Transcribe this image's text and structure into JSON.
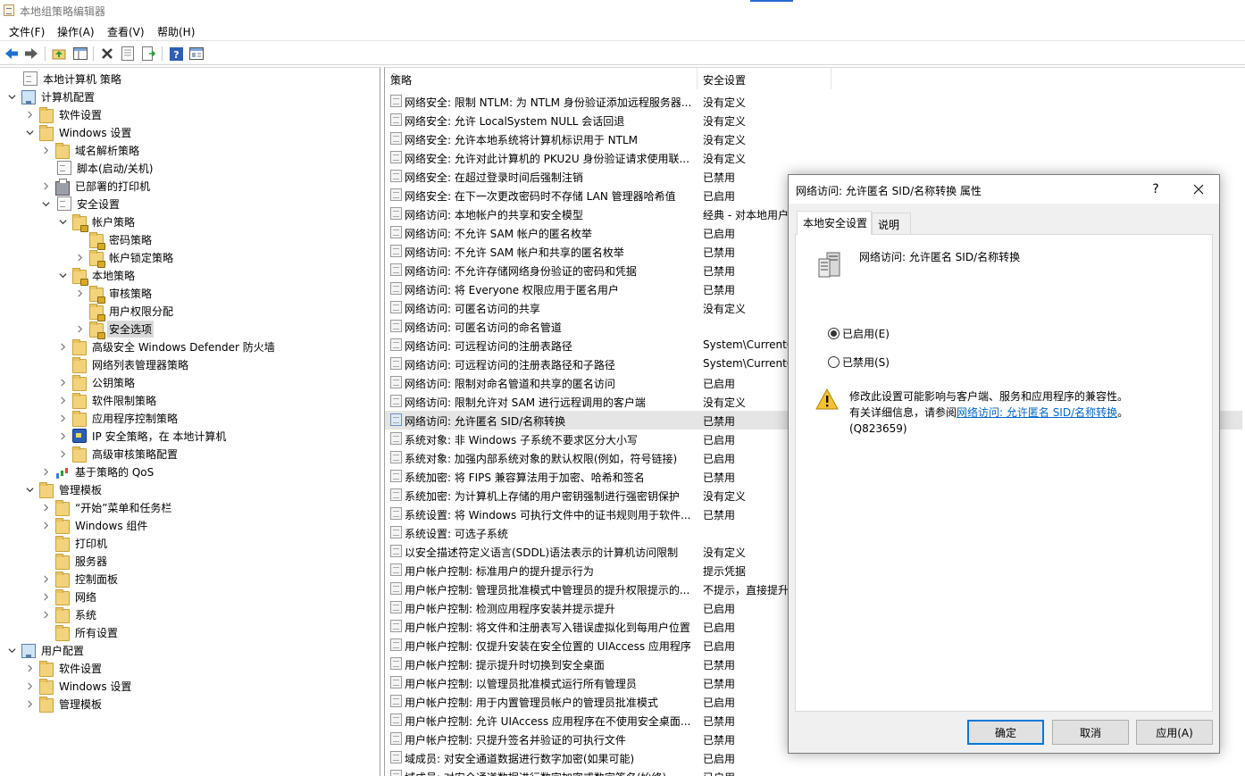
{
  "window": {
    "title": "本地组策略编辑器"
  },
  "menu": [
    "文件(F)",
    "操作(A)",
    "查看(V)",
    "帮助(H)"
  ],
  "toolbar": {
    "buttons": [
      "back-icon",
      "forward-icon",
      "up-folder-icon",
      "show-hide-tree-icon",
      "delete-icon",
      "properties-icon",
      "export-list-icon",
      "help-icon",
      "view-icon"
    ]
  },
  "tree": [
    {
      "label": "本地计算机 策略",
      "level": 0,
      "expander": "none",
      "icon": "policy-doc-icon"
    },
    {
      "label": "计算机配置",
      "level": 0,
      "expander": "open",
      "icon": "computer-icon"
    },
    {
      "label": "软件设置",
      "level": 1,
      "expander": "closed",
      "icon": "folder-icon"
    },
    {
      "label": "Windows 设置",
      "level": 1,
      "expander": "open",
      "icon": "folder-icon"
    },
    {
      "label": "域名解析策略",
      "level": 2,
      "expander": "closed",
      "icon": "folder-icon"
    },
    {
      "label": "脚本(启动/关机)",
      "level": 2,
      "expander": "none",
      "icon": "script-icon"
    },
    {
      "label": "已部署的打印机",
      "level": 2,
      "expander": "closed",
      "icon": "printer-icon"
    },
    {
      "label": "安全设置",
      "level": 2,
      "expander": "open",
      "icon": "security-settings-icon"
    },
    {
      "label": "帐户策略",
      "level": 3,
      "expander": "open",
      "icon": "folder-lock-icon"
    },
    {
      "label": "密码策略",
      "level": 4,
      "expander": "none",
      "icon": "folder-lock-icon"
    },
    {
      "label": "帐户锁定策略",
      "level": 4,
      "expander": "closed",
      "icon": "folder-lock-icon"
    },
    {
      "label": "本地策略",
      "level": 3,
      "expander": "open",
      "icon": "folder-lock-icon"
    },
    {
      "label": "审核策略",
      "level": 4,
      "expander": "closed",
      "icon": "folder-lock-icon"
    },
    {
      "label": "用户权限分配",
      "level": 4,
      "expander": "none",
      "icon": "folder-lock-icon"
    },
    {
      "label": "安全选项",
      "level": 4,
      "expander": "closed",
      "icon": "folder-lock-icon",
      "selected": true
    },
    {
      "label": "高级安全 Windows Defender 防火墙",
      "level": 3,
      "expander": "closed",
      "icon": "folder-icon"
    },
    {
      "label": "网络列表管理器策略",
      "level": 3,
      "expander": "none",
      "icon": "folder-icon"
    },
    {
      "label": "公钥策略",
      "level": 3,
      "expander": "closed",
      "icon": "folder-icon"
    },
    {
      "label": "软件限制策略",
      "level": 3,
      "expander": "closed",
      "icon": "folder-icon"
    },
    {
      "label": "应用程序控制策略",
      "level": 3,
      "expander": "closed",
      "icon": "folder-icon"
    },
    {
      "label": "IP 安全策略，在 本地计算机",
      "level": 3,
      "expander": "closed",
      "icon": "ip-security-icon"
    },
    {
      "label": "高级审核策略配置",
      "level": 3,
      "expander": "closed",
      "icon": "folder-icon"
    },
    {
      "label": "基于策略的 QoS",
      "level": 2,
      "expander": "closed",
      "icon": "qos-chart-icon"
    },
    {
      "label": "管理模板",
      "level": 1,
      "expander": "open",
      "icon": "folder-icon"
    },
    {
      "label": "“开始”菜单和任务栏",
      "level": 2,
      "expander": "closed",
      "icon": "folder-icon"
    },
    {
      "label": "Windows 组件",
      "level": 2,
      "expander": "closed",
      "icon": "folder-icon"
    },
    {
      "label": "打印机",
      "level": 2,
      "expander": "none",
      "icon": "folder-icon"
    },
    {
      "label": "服务器",
      "level": 2,
      "expander": "none",
      "icon": "folder-icon"
    },
    {
      "label": "控制面板",
      "level": 2,
      "expander": "closed",
      "icon": "folder-icon"
    },
    {
      "label": "网络",
      "level": 2,
      "expander": "closed",
      "icon": "folder-icon"
    },
    {
      "label": "系统",
      "level": 2,
      "expander": "closed",
      "icon": "folder-icon"
    },
    {
      "label": "所有设置",
      "level": 2,
      "expander": "none",
      "icon": "folder-doc-icon"
    },
    {
      "label": "用户配置",
      "level": 0,
      "expander": "open",
      "icon": "user-icon"
    },
    {
      "label": "软件设置",
      "level": 1,
      "expander": "closed",
      "icon": "folder-icon"
    },
    {
      "label": "Windows 设置",
      "level": 1,
      "expander": "closed",
      "icon": "folder-icon"
    },
    {
      "label": "管理模板",
      "level": 1,
      "expander": "closed",
      "icon": "folder-icon"
    }
  ],
  "list": {
    "columns": [
      "策略",
      "安全设置"
    ],
    "rows": [
      {
        "policy": "网络安全: 限制 NTLM: 为 NTLM 身份验证添加远程服务器...",
        "setting": "没有定义"
      },
      {
        "policy": "网络安全: 允许 LocalSystem NULL 会话回退",
        "setting": "没有定义"
      },
      {
        "policy": "网络安全: 允许本地系统将计算机标识用于 NTLM",
        "setting": "没有定义"
      },
      {
        "policy": "网络安全: 允许对此计算机的 PKU2U 身份验证请求使用联...",
        "setting": "没有定义"
      },
      {
        "policy": "网络安全: 在超过登录时间后强制注销",
        "setting": "已禁用"
      },
      {
        "policy": "网络安全: 在下一次更改密码时不存储 LAN 管理器哈希值",
        "setting": "已启用"
      },
      {
        "policy": "网络访问: 本地帐户的共享和安全模型",
        "setting": "经典 - 对本地用户"
      },
      {
        "policy": "网络访问: 不允许 SAM 帐户的匿名枚举",
        "setting": "已启用"
      },
      {
        "policy": "网络访问: 不允许 SAM 帐户和共享的匿名枚举",
        "setting": "已禁用"
      },
      {
        "policy": "网络访问: 不允许存储网络身份验证的密码和凭据",
        "setting": "已禁用"
      },
      {
        "policy": "网络访问: 将 Everyone 权限应用于匿名用户",
        "setting": "已禁用"
      },
      {
        "policy": "网络访问: 可匿名访问的共享",
        "setting": "没有定义"
      },
      {
        "policy": "网络访问: 可匿名访问的命名管道",
        "setting": ""
      },
      {
        "policy": "网络访问: 可远程访问的注册表路径",
        "setting": "System\\CurrentC"
      },
      {
        "policy": "网络访问: 可远程访问的注册表路径和子路径",
        "setting": "System\\CurrentC"
      },
      {
        "policy": "网络访问: 限制对命名管道和共享的匿名访问",
        "setting": "已启用"
      },
      {
        "policy": "网络访问: 限制允许对 SAM 进行远程调用的客户端",
        "setting": "没有定义"
      },
      {
        "policy": "网络访问: 允许匿名 SID/名称转换",
        "setting": "已禁用",
        "selected": true
      },
      {
        "policy": "系统对象: 非 Windows 子系统不要求区分大小写",
        "setting": "已启用"
      },
      {
        "policy": "系统对象: 加强内部系统对象的默认权限(例如，符号链接)",
        "setting": "已启用"
      },
      {
        "policy": "系统加密: 将 FIPS 兼容算法用于加密、哈希和签名",
        "setting": "已禁用"
      },
      {
        "policy": "系统加密: 为计算机上存储的用户密钥强制进行强密钥保护",
        "setting": "没有定义"
      },
      {
        "policy": "系统设置: 将 Windows 可执行文件中的证书规则用于软件...",
        "setting": "已禁用"
      },
      {
        "policy": "系统设置: 可选子系统",
        "setting": ""
      },
      {
        "policy": "以安全描述符定义语言(SDDL)语法表示的计算机访问限制",
        "setting": "没有定义"
      },
      {
        "policy": "用户帐户控制: 标准用户的提升提示行为",
        "setting": "提示凭据"
      },
      {
        "policy": "用户帐户控制: 管理员批准模式中管理员的提升权限提示的...",
        "setting": "不提示，直接提升"
      },
      {
        "policy": "用户帐户控制: 检测应用程序安装并提示提升",
        "setting": "已启用"
      },
      {
        "policy": "用户帐户控制: 将文件和注册表写入错误虚拟化到每用户位置",
        "setting": "已启用"
      },
      {
        "policy": "用户帐户控制: 仅提升安装在安全位置的 UIAccess 应用程序",
        "setting": "已启用"
      },
      {
        "policy": "用户帐户控制: 提示提升时切换到安全桌面",
        "setting": "已禁用"
      },
      {
        "policy": "用户帐户控制: 以管理员批准模式运行所有管理员",
        "setting": "已禁用"
      },
      {
        "policy": "用户帐户控制: 用于内置管理员帐户的管理员批准模式",
        "setting": "已启用"
      },
      {
        "policy": "用户帐户控制: 允许 UIAccess 应用程序在不使用安全桌面...",
        "setting": "已禁用"
      },
      {
        "policy": "用户帐户控制: 只提升签名并验证的可执行文件",
        "setting": "已禁用"
      },
      {
        "policy": "域成员: 对安全通道数据进行数字加密(如果可能)",
        "setting": "已启用"
      },
      {
        "policy": "域成员: 对安全通道数据进行数字加密或数字签名(始终)",
        "setting": "已启用"
      }
    ]
  },
  "dialog": {
    "title": "网络访问: 允许匿名 SID/名称转换 属性",
    "help_glyph": "?",
    "close_glyph": "✕",
    "tabs": [
      "本地安全设置",
      "说明"
    ],
    "active_tab": 0,
    "policy_name": "网络访问: 允许匿名 SID/名称转换",
    "options": [
      {
        "label": "已启用(E)",
        "checked": true
      },
      {
        "label": "已禁用(S)",
        "checked": false
      }
    ],
    "warning_line1": "修改此设置可能影响与客户端、服务和应用程序的兼容性。",
    "warning_prefix": "有关详细信息，请参阅",
    "warning_link": "网络访问: 允许匿名 SID/名称转换",
    "warning_suffix": "。",
    "warning_ref": "(Q823659)",
    "buttons": {
      "ok": "确定",
      "cancel": "取消",
      "apply": "应用(A)"
    }
  }
}
